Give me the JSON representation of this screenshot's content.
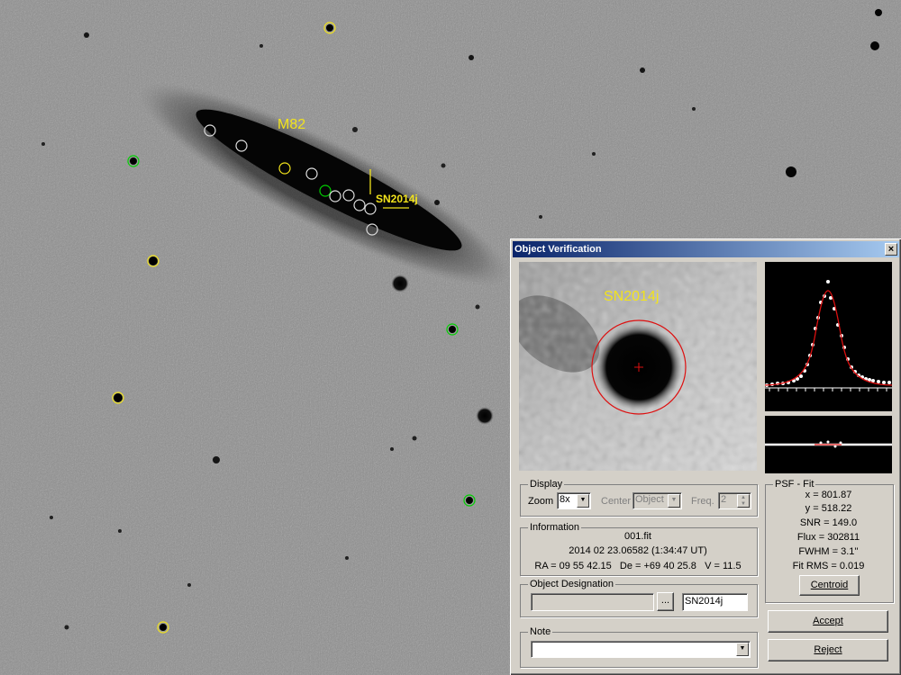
{
  "sky": {
    "labels": {
      "galaxy": "M82",
      "supernova": "SN2014j"
    }
  },
  "dialog": {
    "title": "Object Verification",
    "close_glyph": "×",
    "zoom_label": "SN2014j",
    "display": {
      "legend": "Display",
      "zoom_label": "Zoom",
      "zoom_value": "8x",
      "center_label": "Center",
      "center_value": "Object",
      "freq_label": "Freq.",
      "freq_value": "2"
    },
    "psf": {
      "legend": "PSF - Fit",
      "x": "x = 801.87",
      "y": "y = 518.22",
      "snr": "SNR = 149.0",
      "flux": "Flux = 302811",
      "fwhm": "FWHM = 3.1''",
      "fit_rms": "Fit RMS = 0.019",
      "centroid_button": "Centroid"
    },
    "information": {
      "legend": "Information",
      "file": "001.fit",
      "datetime": "2014 02 23.06582 (1:34:47 UT)",
      "coords": "RA = 09 55 42.15   De = +69 40 25.8   V = 11.5"
    },
    "designation": {
      "legend": "Object Designation",
      "browse_button": "...",
      "value": "SN2014j"
    },
    "note": {
      "legend": "Note",
      "value": ""
    },
    "accept_button": "Accept",
    "reject_button": "Reject"
  },
  "colors": {
    "marker_yellow": "#f2e31c",
    "marker_green": "#00d000",
    "marker_white": "#ffffff",
    "fit_red": "#dd1010"
  }
}
